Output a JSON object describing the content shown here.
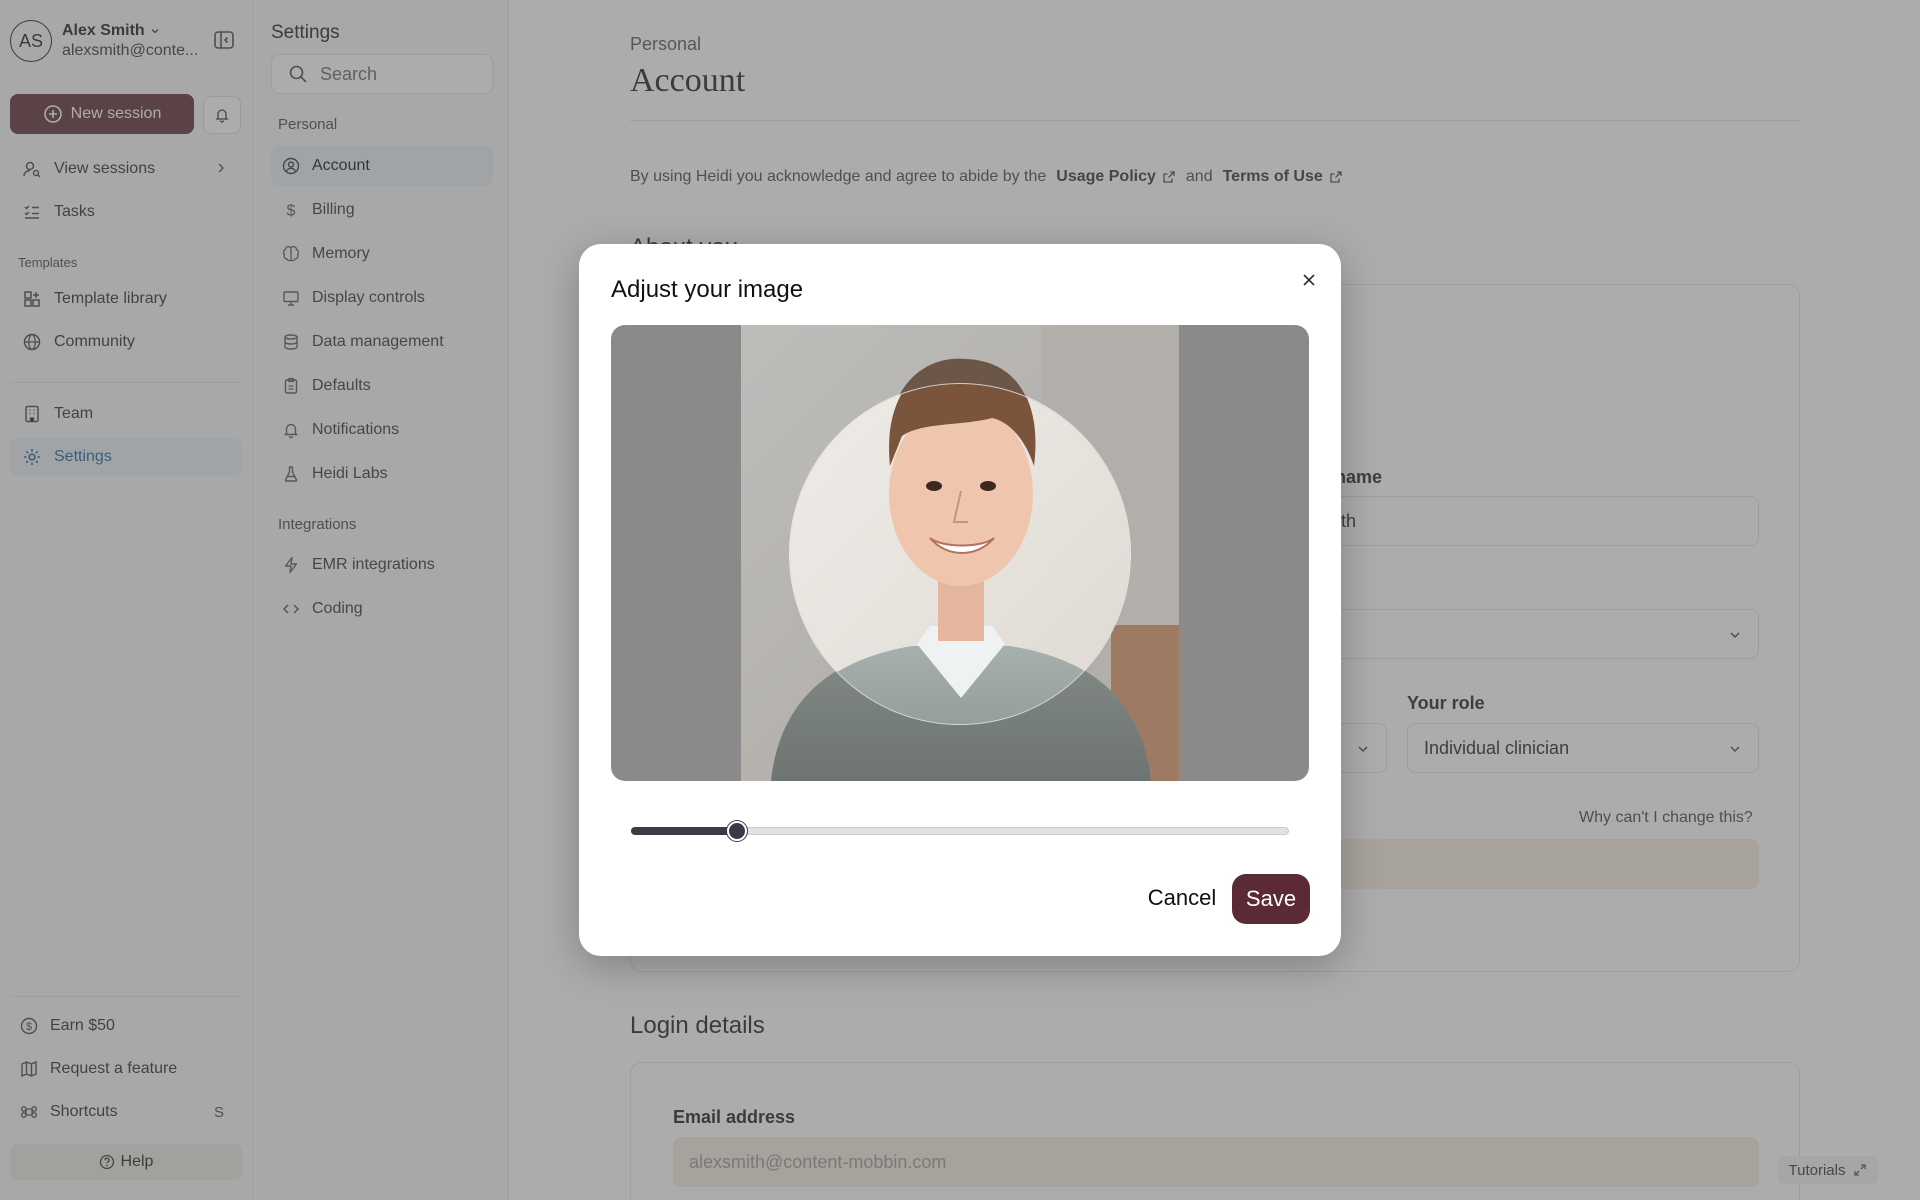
{
  "user": {
    "initials": "AS",
    "name": "Alex Smith",
    "email": "alexsmith@conte..."
  },
  "sidebar": {
    "new_session": "New session",
    "items": [
      {
        "label": "View sessions"
      },
      {
        "label": "Tasks"
      },
      {
        "label": "Template library"
      },
      {
        "label": "Community"
      },
      {
        "label": "Team"
      },
      {
        "label": "Settings"
      }
    ],
    "templates_label": "Templates",
    "footer": [
      {
        "label": "Earn $50"
      },
      {
        "label": "Request a feature"
      },
      {
        "label": "Shortcuts",
        "key": "S"
      }
    ],
    "help": "Help"
  },
  "settings": {
    "title": "Settings",
    "search_placeholder": "Search",
    "personal_label": "Personal",
    "personal_items": [
      {
        "label": "Account"
      },
      {
        "label": "Billing"
      },
      {
        "label": "Memory"
      },
      {
        "label": "Display controls"
      },
      {
        "label": "Data management"
      },
      {
        "label": "Defaults"
      },
      {
        "label": "Notifications"
      },
      {
        "label": "Heidi Labs"
      }
    ],
    "integrations_label": "Integrations",
    "integration_items": [
      {
        "label": "EMR integrations"
      },
      {
        "label": "Coding"
      }
    ]
  },
  "main": {
    "breadcrumb": "Personal",
    "title": "Account",
    "terms_text": "By using Heidi you acknowledge and agree to abide by the",
    "usage_policy": "Usage Policy",
    "and": "and",
    "terms_of_use": "Terms of Use",
    "about_heading": "About you",
    "last_name_label": "Last name",
    "last_name_value": "Smith",
    "role_label": "Your role",
    "role_value": "Individual clinician",
    "why_link": "Why can't I change this?",
    "login_heading": "Login details",
    "email_label": "Email address",
    "email_value": "alexsmith@content-mobbin.com",
    "tutorials": "Tutorials"
  },
  "modal": {
    "title": "Adjust your image",
    "zoom_level": 0.15,
    "cancel": "Cancel",
    "save": "Save"
  },
  "colors": {
    "brand": "#5b2a35",
    "active_nav_bg": "#e6eef5",
    "active_nav_text": "#1a5f9e",
    "notice_bg": "#f4eadf"
  }
}
